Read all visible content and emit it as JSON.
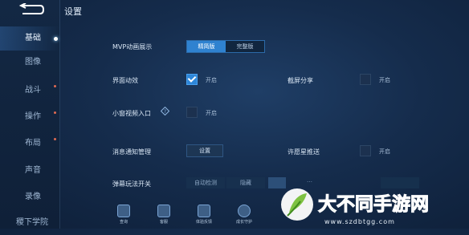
{
  "header": {
    "title": "设置"
  },
  "sidebar": {
    "items": [
      {
        "label": "基础"
      },
      {
        "label": "图像"
      },
      {
        "label": "战斗"
      },
      {
        "label": "操作"
      },
      {
        "label": "布局"
      },
      {
        "label": "声音"
      },
      {
        "label": "录像"
      },
      {
        "label": "稷下学院"
      }
    ]
  },
  "settings": {
    "mvp": {
      "label": "MVP动画展示",
      "options": [
        "精简版",
        "完整版"
      ],
      "selected": "精简版"
    },
    "ui_effects": {
      "label": "界面动效",
      "value_label": "开启",
      "checked": true
    },
    "screenshot_share": {
      "label": "截屏分享",
      "value_label": "开启",
      "checked": false
    },
    "mini_video": {
      "label": "小窗视频入口",
      "value_label": "开启",
      "checked": false
    },
    "notifications": {
      "label": "消息通知管理",
      "button_label": "设置"
    },
    "wish_star": {
      "label": "许愿星推送",
      "value_label": "开启",
      "checked": false
    },
    "danmaku": {
      "label": "弹幕玩法开关",
      "options": [
        "自动检测",
        "隐藏"
      ],
      "partial_text": "…"
    }
  },
  "bottom_bar": {
    "items": [
      {
        "label": "查询",
        "icon": "search-icon"
      },
      {
        "label": "客服",
        "icon": "customer-service-icon"
      },
      {
        "label": "体验反馈",
        "icon": "feedback-icon"
      },
      {
        "label": "成长守护",
        "icon": "growth-guard-icon"
      }
    ]
  },
  "watermark": {
    "text": "大不同手游网",
    "url": "www.szdbtgg.com"
  },
  "colors": {
    "accent": "#2f82d0",
    "background": "#152c4c",
    "dot": "#e06a52"
  }
}
